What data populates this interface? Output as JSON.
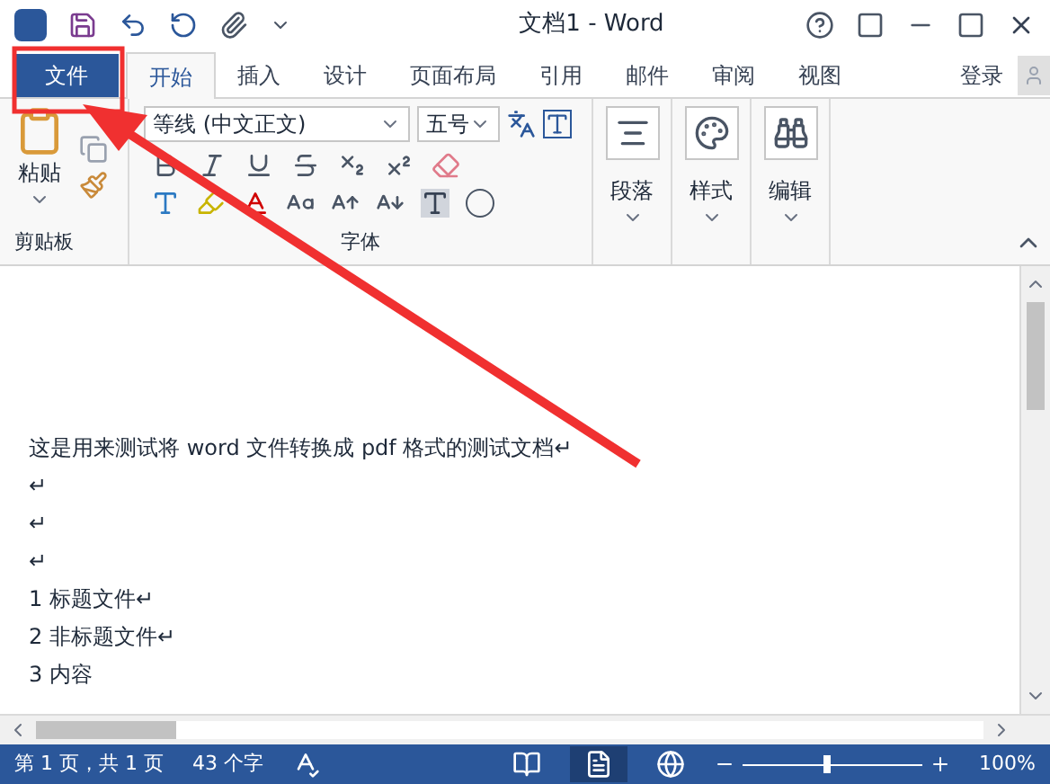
{
  "window": {
    "title": "文档1 - Word"
  },
  "tabs": [
    {
      "label": "文件",
      "kind": "file",
      "selected": false
    },
    {
      "label": "开始",
      "kind": "tab",
      "selected": true
    },
    {
      "label": "插入",
      "kind": "tab",
      "selected": false
    },
    {
      "label": "设计",
      "kind": "tab",
      "selected": false
    },
    {
      "label": "页面布局",
      "kind": "tab",
      "selected": false
    },
    {
      "label": "引用",
      "kind": "tab",
      "selected": false
    },
    {
      "label": "邮件",
      "kind": "tab",
      "selected": false
    },
    {
      "label": "审阅",
      "kind": "tab",
      "selected": false
    },
    {
      "label": "视图",
      "kind": "tab",
      "selected": false
    }
  ],
  "sign_in": "登录",
  "ribbon": {
    "clipboard": {
      "paste": "粘贴",
      "label": "剪贴板"
    },
    "font": {
      "font_name": "等线 (中文正文)",
      "font_size": "五号",
      "label": "字体"
    },
    "big_buttons": [
      "段落",
      "样式",
      "编辑"
    ]
  },
  "document": {
    "lines": [
      "这是用来测试将 word 文件转换成 pdf 格式的测试文档↵",
      "↵",
      "↵",
      "↵",
      "1  标题文件↵",
      "2  非标题文件↵",
      "3  内容"
    ]
  },
  "status_bar": {
    "page": "第 1 页，共 1 页",
    "words": "43 个字",
    "zoom": {
      "level": 0.45,
      "reading": "100%"
    }
  }
}
